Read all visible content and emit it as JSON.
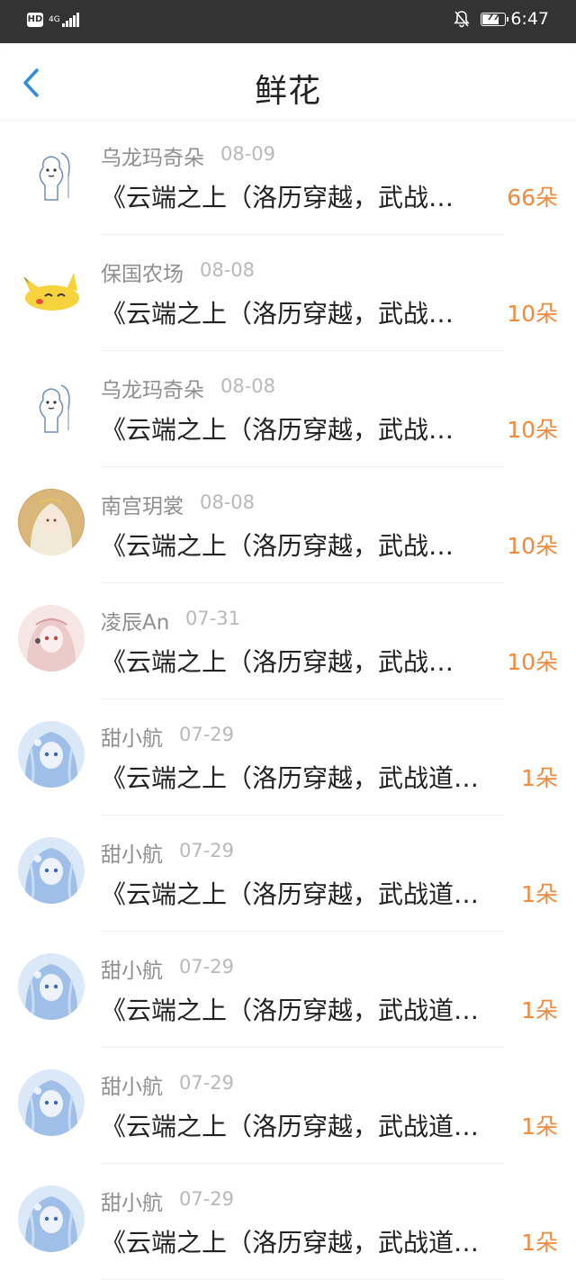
{
  "status_bar": {
    "hd": "HD",
    "network": "4G",
    "battery": "77",
    "battery_level": 0.77,
    "time": "6:47"
  },
  "header": {
    "title": "鲜花",
    "back_icon": "chevron-left-icon"
  },
  "colors": {
    "accent_blue": "#2f8ce6",
    "count_orange": "#f08a3c",
    "name_gray": "#8f8f8f",
    "date_gray": "#b9b9b9"
  },
  "items": [
    {
      "name": "乌龙玛奇朵",
      "date": "08-09",
      "title": "《云端之上（洛历穿越，武战…",
      "count": "66朵",
      "avatar": "alpaca-avatar"
    },
    {
      "name": "保国农场",
      "date": "08-08",
      "title": "《云端之上（洛历穿越，武战…",
      "count": "10朵",
      "avatar": "pikachu-avatar"
    },
    {
      "name": "乌龙玛奇朵",
      "date": "08-08",
      "title": "《云端之上（洛历穿越，武战…",
      "count": "10朵",
      "avatar": "alpaca-avatar"
    },
    {
      "name": "南宫玥裳",
      "date": "08-08",
      "title": "《云端之上（洛历穿越，武战…",
      "count": "10朵",
      "avatar": "anime-girl-gold-avatar"
    },
    {
      "name": "凌辰An",
      "date": "07-31",
      "title": "《云端之上（洛历穿越，武战…",
      "count": "10朵",
      "avatar": "anime-girl-pink-avatar"
    },
    {
      "name": "甜小航",
      "date": "07-29",
      "title": "《云端之上（洛历穿越，武战道…",
      "count": "1朵",
      "avatar": "anime-girl-blue-avatar"
    },
    {
      "name": "甜小航",
      "date": "07-29",
      "title": "《云端之上（洛历穿越，武战道…",
      "count": "1朵",
      "avatar": "anime-girl-blue-avatar"
    },
    {
      "name": "甜小航",
      "date": "07-29",
      "title": "《云端之上（洛历穿越，武战道…",
      "count": "1朵",
      "avatar": "anime-girl-blue-avatar"
    },
    {
      "name": "甜小航",
      "date": "07-29",
      "title": "《云端之上（洛历穿越，武战道…",
      "count": "1朵",
      "avatar": "anime-girl-blue-avatar"
    },
    {
      "name": "甜小航",
      "date": "07-29",
      "title": "《云端之上（洛历穿越，武战道…",
      "count": "1朵",
      "avatar": "anime-girl-blue-avatar"
    }
  ]
}
